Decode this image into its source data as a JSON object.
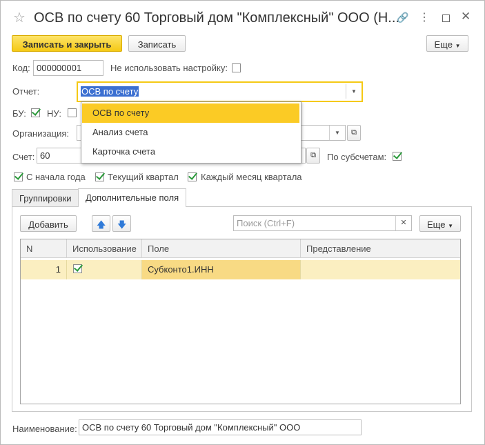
{
  "window": {
    "title": "ОСВ по счету 60 Торговый дом \"Комплексный\" ООО (Н..."
  },
  "toolbar": {
    "save_close_label": "Записать и закрыть",
    "save_label": "Записать",
    "more_label": "Еще"
  },
  "form": {
    "code_label": "Код:",
    "code_value": "000000001",
    "no_setting_label": "Не использовать настройку:",
    "report_label": "Отчет:",
    "report_value": "ОСВ по счету",
    "bu_label": "БУ:",
    "nu_label": "НУ:",
    "org_label": "Организация:",
    "account_label": "Счет:",
    "account_value": "60",
    "by_subaccounts_label": "По субсчетам:",
    "from_year_start_label": "С начала года",
    "current_quarter_label": "Текущий квартал",
    "each_month_label": "Каждый месяц квартала",
    "name_label": "Наименование:",
    "name_value": "ОСВ по счету 60 Торговый дом \"Комплексный\" ООО"
  },
  "dropdown": {
    "options": [
      "ОСВ по счету",
      "Анализ счета",
      "Карточка счета"
    ],
    "selected": "ОСВ по счету"
  },
  "tabs": [
    {
      "label": "Группировки",
      "active": false
    },
    {
      "label": "Дополнительные поля",
      "active": true
    }
  ],
  "panel": {
    "add_label": "Добавить",
    "search_placeholder": "Поиск (Ctrl+F)",
    "more_label": "Еще"
  },
  "table": {
    "columns": [
      "N",
      "Использование",
      "Поле",
      "Представление"
    ],
    "rows": [
      {
        "n": "1",
        "used": true,
        "field": "Субконто1.ИНН",
        "presentation": ""
      }
    ]
  },
  "checkboxes": {
    "no_setting": false,
    "bu": true,
    "nu": false,
    "by_subaccounts": true,
    "from_year_start": true,
    "current_quarter": true,
    "each_month": true
  },
  "colors": {
    "accent_yellow": "#f5c914",
    "row_highlight": "#fbefc1",
    "check_green": "#2a9a3a"
  },
  "icons": [
    "star-icon",
    "link-icon",
    "kebab-icon",
    "maximize-icon",
    "close-icon",
    "arrow-up-icon",
    "arrow-down-icon",
    "open-icon",
    "clear-icon"
  ]
}
